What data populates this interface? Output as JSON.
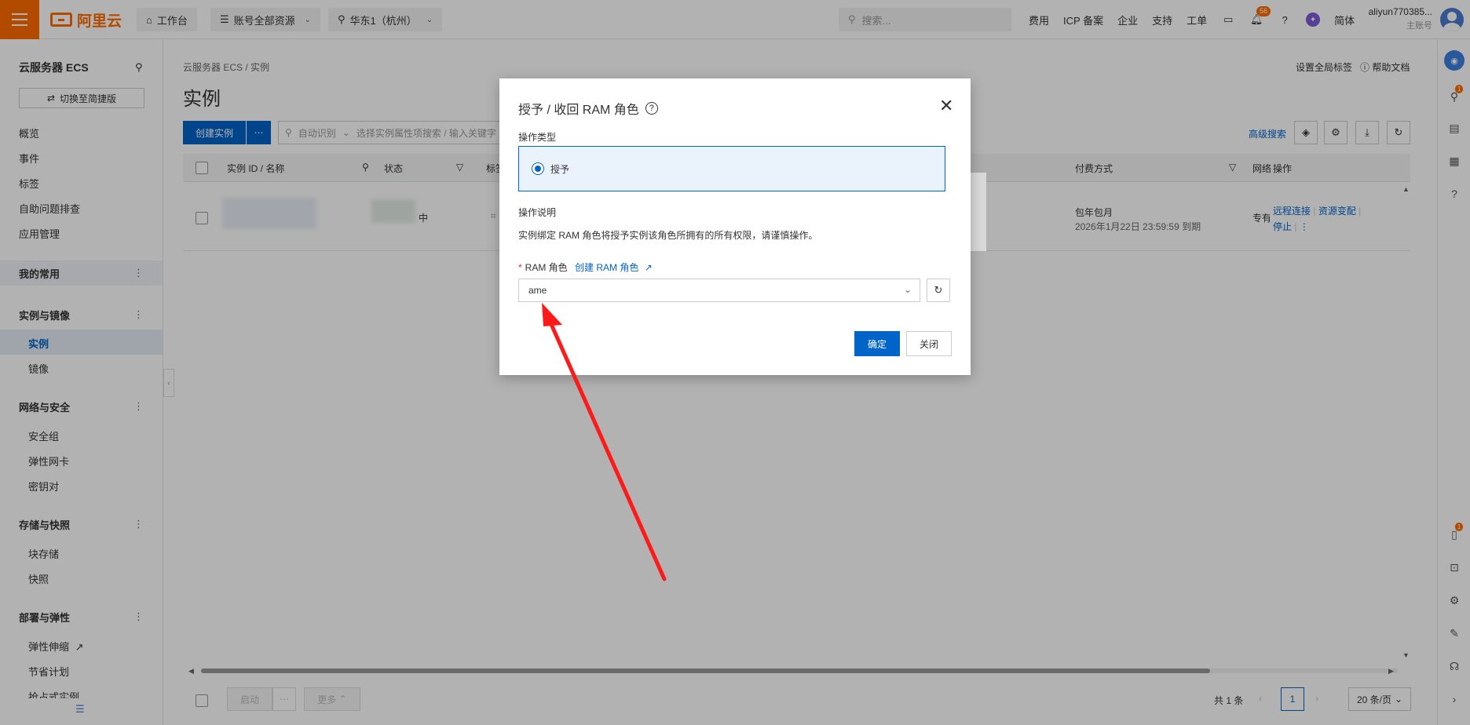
{
  "topbar": {
    "logo_text": "阿里云",
    "workbench": "工作台",
    "resources": "账号全部资源",
    "region": "华东1（杭州）",
    "search_placeholder": "搜索...",
    "nav": [
      "费用",
      "ICP 备案",
      "企业",
      "支持",
      "工单"
    ],
    "notif_count": "56",
    "lang": "简体",
    "username": "aliyun770385...",
    "account_type": "主账号"
  },
  "sidebar": {
    "title": "云服务器 ECS",
    "switch_label": "切换至简捷版",
    "top_items": [
      "概览",
      "事件",
      "标签",
      "自助问题排查",
      "应用管理"
    ],
    "group_favorites": "我的常用",
    "group_instances": "实例与镜像",
    "instances_items": [
      "实例",
      "镜像"
    ],
    "group_network": "网络与安全",
    "network_items": [
      "安全组",
      "弹性网卡",
      "密钥对"
    ],
    "group_storage": "存储与快照",
    "storage_items": [
      "块存储",
      "快照"
    ],
    "group_deploy": "部署与弹性",
    "deploy_items": [
      "弹性伸缩",
      "节省计划",
      "抢占式实例"
    ]
  },
  "main": {
    "breadcrumb": "云服务器 ECS  /  实例",
    "title": "实例",
    "global_tags": "设置全局标签",
    "help_docs": "帮助文档",
    "create_btn": "创建实例",
    "filter_mode": "自动识别",
    "filter_placeholder": "选择实例属性项搜索 / 输入关键字",
    "adv_search": "高级搜索",
    "columns": [
      "实例 ID / 名称",
      "状态",
      "标签",
      "付费方式",
      "网络",
      "操作"
    ],
    "row": {
      "status_suffix": "中",
      "billing": "包年包月",
      "expire": "2026年1月22日 23:59:59  到期",
      "network_prefix": "专有",
      "ops": [
        "远程连接",
        "资源变配",
        "停止"
      ]
    },
    "footer": {
      "start": "启动",
      "more": "更多",
      "total": "共 1 条",
      "page": "1",
      "page_size": "20 条/页"
    }
  },
  "modal": {
    "title": "授予 / 收回 RAM 角色",
    "op_type_label": "操作类型",
    "grant_option": "授予",
    "desc_label": "操作说明",
    "desc_text": "实例绑定 RAM 角色将授予实例该角色所拥有的所有权限，请谨慎操作。",
    "ram_label": "RAM 角色",
    "create_ram": "创建 RAM 角色",
    "selected_role": "ame",
    "confirm": "确定",
    "close": "关闭"
  },
  "colors": {
    "brand": "#ff6a00",
    "primary": "#0064c8",
    "annotation_arrow": "#ff1a1a"
  }
}
